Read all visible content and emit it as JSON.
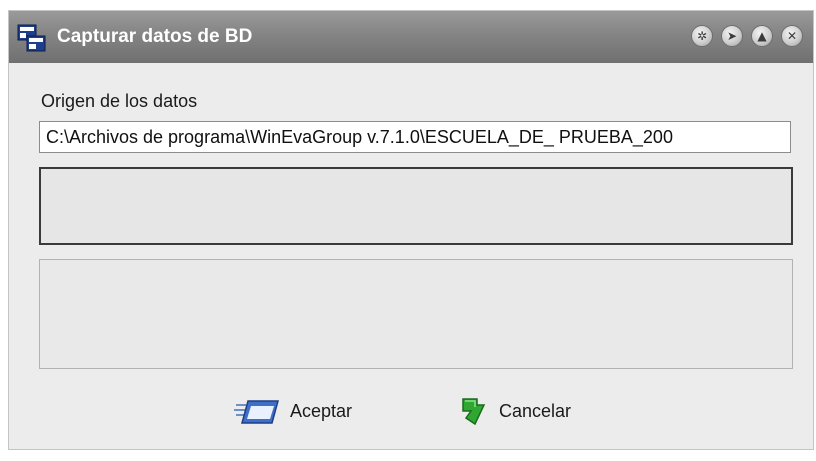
{
  "window": {
    "title": "Capturar datos de BD"
  },
  "icons": {
    "app": "database-capture-icon",
    "title_buttons": [
      "wand-icon",
      "pin-icon",
      "maximize-icon",
      "close-icon"
    ],
    "accept": "window-accept-icon",
    "cancel": "green-arrow-back-icon"
  },
  "form": {
    "source_label": "Origen de los datos",
    "source_value": "C:\\Archivos de programa\\WinEvaGroup v.7.1.0\\ESCUELA_DE_ PRUEBA_200"
  },
  "buttons": {
    "accept_label": "Aceptar",
    "cancel_label": "Cancelar"
  },
  "colors": {
    "titlebar": "#848484",
    "window_bg": "#ececec",
    "cancel_icon": "#2fa832"
  }
}
